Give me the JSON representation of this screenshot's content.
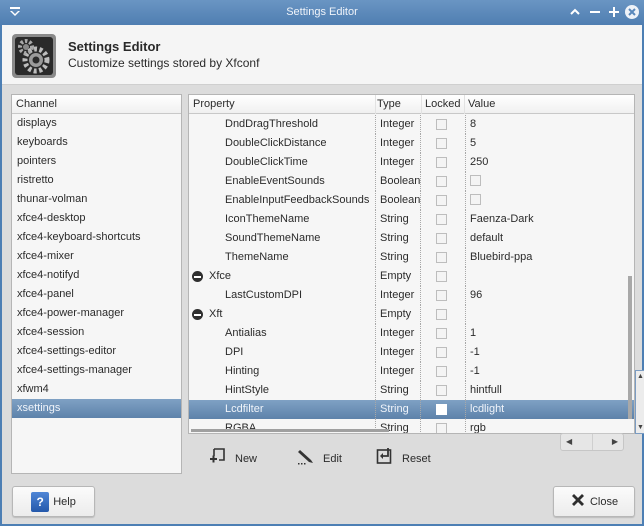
{
  "window": {
    "title": "Settings Editor"
  },
  "header": {
    "title": "Settings Editor",
    "subtitle": "Customize settings stored by Xfconf"
  },
  "channels": {
    "column_header": "Channel",
    "items": [
      {
        "label": "displays",
        "selected": false
      },
      {
        "label": "keyboards",
        "selected": false
      },
      {
        "label": "pointers",
        "selected": false
      },
      {
        "label": "ristretto",
        "selected": false
      },
      {
        "label": "thunar-volman",
        "selected": false
      },
      {
        "label": "xfce4-desktop",
        "selected": false
      },
      {
        "label": "xfce4-keyboard-shortcuts",
        "selected": false
      },
      {
        "label": "xfce4-mixer",
        "selected": false
      },
      {
        "label": "xfce4-notifyd",
        "selected": false
      },
      {
        "label": "xfce4-panel",
        "selected": false
      },
      {
        "label": "xfce4-power-manager",
        "selected": false
      },
      {
        "label": "xfce4-session",
        "selected": false
      },
      {
        "label": "xfce4-settings-editor",
        "selected": false
      },
      {
        "label": "xfce4-settings-manager",
        "selected": false
      },
      {
        "label": "xfwm4",
        "selected": false
      },
      {
        "label": "xsettings",
        "selected": true
      }
    ]
  },
  "properties": {
    "columns": {
      "property": "Property",
      "type": "Type",
      "locked": "Locked",
      "value": "Value"
    },
    "rows": [
      {
        "name": "DndDragThreshold",
        "type": "Integer",
        "locked": false,
        "value": "8",
        "group": false
      },
      {
        "name": "DoubleClickDistance",
        "type": "Integer",
        "locked": false,
        "value": "5",
        "group": false
      },
      {
        "name": "DoubleClickTime",
        "type": "Integer",
        "locked": false,
        "value": "250",
        "group": false
      },
      {
        "name": "EnableEventSounds",
        "type": "Boolean",
        "locked": false,
        "value_bool": false,
        "group": false
      },
      {
        "name": "EnableInputFeedbackSounds",
        "type": "Boolean",
        "locked": false,
        "value_bool": false,
        "group": false
      },
      {
        "name": "IconThemeName",
        "type": "String",
        "locked": false,
        "value": "Faenza-Dark",
        "group": false
      },
      {
        "name": "SoundThemeName",
        "type": "String",
        "locked": false,
        "value": "default",
        "group": false
      },
      {
        "name": "ThemeName",
        "type": "String",
        "locked": false,
        "value": "Bluebird-ppa",
        "group": false
      },
      {
        "name": "Xfce",
        "type": "Empty",
        "locked": false,
        "value": "",
        "group": true,
        "expanded": true
      },
      {
        "name": "LastCustomDPI",
        "type": "Integer",
        "locked": false,
        "value": "96",
        "group": false
      },
      {
        "name": "Xft",
        "type": "Empty",
        "locked": false,
        "value": "",
        "group": true,
        "expanded": true
      },
      {
        "name": "Antialias",
        "type": "Integer",
        "locked": false,
        "value": "1",
        "group": false
      },
      {
        "name": "DPI",
        "type": "Integer",
        "locked": false,
        "value": "-1",
        "group": false
      },
      {
        "name": "Hinting",
        "type": "Integer",
        "locked": false,
        "value": "-1",
        "group": false
      },
      {
        "name": "HintStyle",
        "type": "String",
        "locked": false,
        "value": "hintfull",
        "group": false
      },
      {
        "name": "Lcdfilter",
        "type": "String",
        "locked": false,
        "value": "lcdlight",
        "group": false,
        "selected": true
      },
      {
        "name": "RGBA",
        "type": "String",
        "locked": false,
        "value": "rgb",
        "group": false
      }
    ]
  },
  "actions": {
    "new_label": "New",
    "edit_label": "Edit",
    "reset_label": "Reset"
  },
  "footer": {
    "help_label": "Help",
    "close_label": "Close"
  },
  "colors": {
    "titlebar": "#5a88bb",
    "selection": "#6a8db4"
  }
}
